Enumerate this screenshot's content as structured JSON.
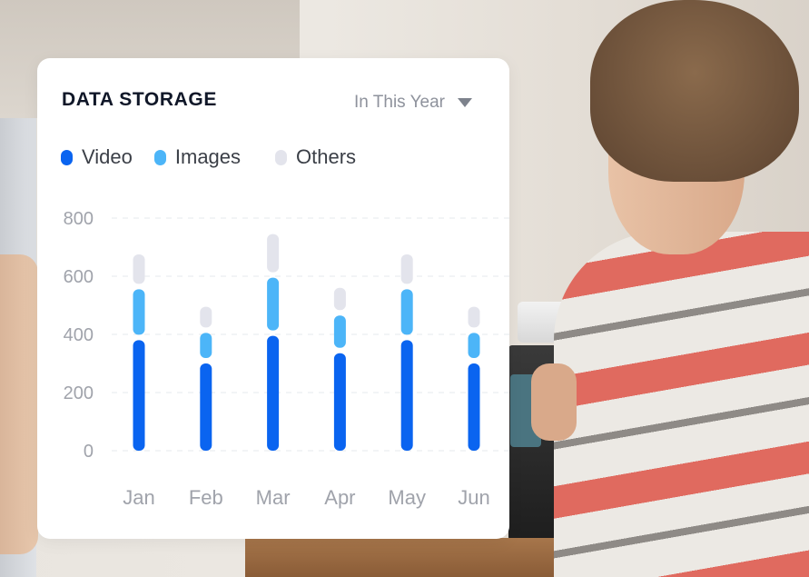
{
  "card": {
    "title": "DATA STORAGE",
    "period": "In This Year",
    "period_icon": "chevron-down-icon"
  },
  "colors": {
    "video": "#0a64f0",
    "images": "#4cb5f8",
    "others": "#e3e4ec",
    "gridline": "#e6e8ee"
  },
  "legend": [
    {
      "label": "Video",
      "color": "#0a64f0"
    },
    {
      "label": "Images",
      "color": "#4cb5f8"
    },
    {
      "label": "Others",
      "color": "#e3e4ec"
    }
  ],
  "chart_data": {
    "type": "bar",
    "stacked": true,
    "categories": [
      "Jan",
      "Feb",
      "Mar",
      "Apr",
      "May",
      "Jun"
    ],
    "series": [
      {
        "name": "Video",
        "values": [
          380,
          300,
          395,
          335,
          380,
          300
        ]
      },
      {
        "name": "Images",
        "values": [
          175,
          105,
          200,
          130,
          175,
          105
        ]
      },
      {
        "name": "Others",
        "values": [
          120,
          90,
          150,
          95,
          120,
          90
        ]
      }
    ],
    "yticks": [
      0,
      200,
      400,
      600,
      800
    ],
    "ylim": [
      0,
      800
    ],
    "grid": true,
    "legend_position": "top-left"
  }
}
